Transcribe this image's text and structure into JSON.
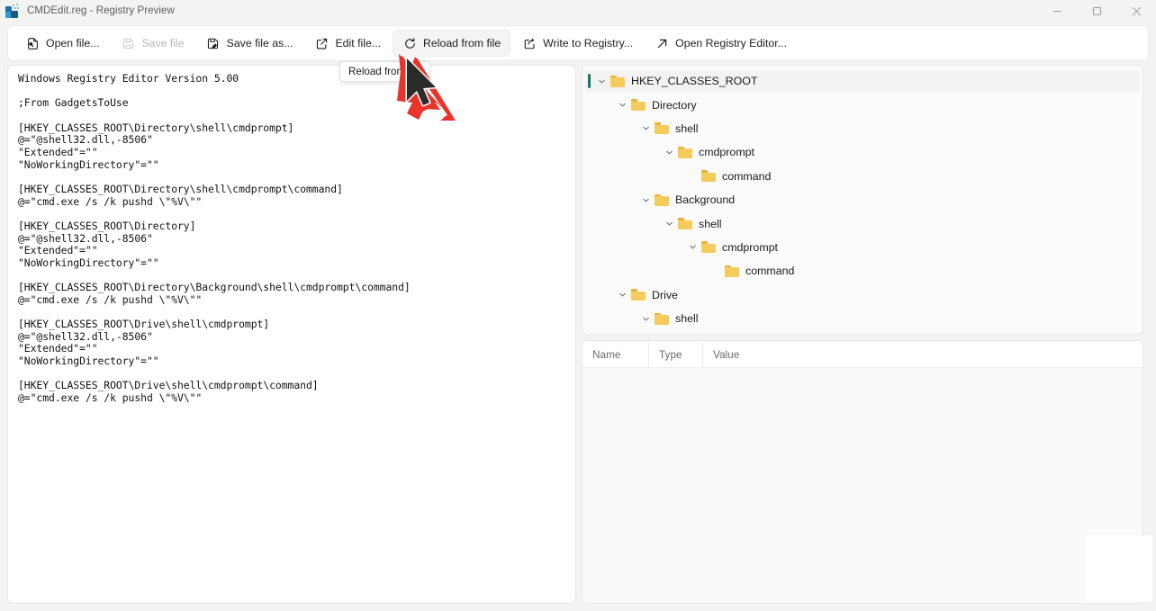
{
  "window": {
    "title": "CMDEdit.reg - Registry Preview",
    "app_icon": "registry-preview-icon",
    "controls": {
      "minimize": "minimize-icon",
      "maximize": "maximize-restore-icon",
      "close": "close-icon"
    }
  },
  "toolbar": {
    "buttons": [
      {
        "label": "Open file...",
        "icon": "open-file-icon",
        "disabled": false,
        "hovered": false
      },
      {
        "label": "Save file",
        "icon": "save-file-icon",
        "disabled": true,
        "hovered": false
      },
      {
        "label": "Save file as...",
        "icon": "save-file-as-icon",
        "disabled": false,
        "hovered": false
      },
      {
        "label": "Edit file...",
        "icon": "edit-file-icon",
        "disabled": false,
        "hovered": false
      },
      {
        "label": "Reload from file",
        "icon": "reload-icon",
        "disabled": false,
        "hovered": true
      },
      {
        "label": "Write to Registry...",
        "icon": "write-to-registry-icon",
        "disabled": false,
        "hovered": false
      },
      {
        "label": "Open Registry Editor...",
        "icon": "open-registry-editor-icon",
        "disabled": false,
        "hovered": false
      }
    ]
  },
  "tooltip": {
    "visible": true,
    "text": "Reload from file"
  },
  "editor": {
    "content": "Windows Registry Editor Version 5.00\n\n;From GadgetsToUse\n\n[HKEY_CLASSES_ROOT\\Directory\\shell\\cmdprompt]\n@=\"@shell32.dll,-8506\"\n\"Extended\"=\"\"\n\"NoWorkingDirectory\"=\"\"\n\n[HKEY_CLASSES_ROOT\\Directory\\shell\\cmdprompt\\command]\n@=\"cmd.exe /s /k pushd \\\"%V\\\"\"\n\n[HKEY_CLASSES_ROOT\\Directory]\n@=\"@shell32.dll,-8506\"\n\"Extended\"=\"\"\n\"NoWorkingDirectory\"=\"\"\n\n[HKEY_CLASSES_ROOT\\Directory\\Background\\shell\\cmdprompt\\command]\n@=\"cmd.exe /s /k pushd \\\"%V\\\"\"\n\n[HKEY_CLASSES_ROOT\\Drive\\shell\\cmdprompt]\n@=\"@shell32.dll,-8506\"\n\"Extended\"=\"\"\n\"NoWorkingDirectory\"=\"\"\n\n[HKEY_CLASSES_ROOT\\Drive\\shell\\cmdprompt\\command]\n@=\"cmd.exe /s /k pushd \\\"%V\\\"\""
  },
  "tree": {
    "selection_accent": "#0f7b6c",
    "nodes": [
      {
        "label": "HKEY_CLASSES_ROOT",
        "depth": 0,
        "expanded": true,
        "selected": true
      },
      {
        "label": "Directory",
        "depth": 1,
        "expanded": true,
        "selected": false
      },
      {
        "label": "shell",
        "depth": 2,
        "expanded": true,
        "selected": false
      },
      {
        "label": "cmdprompt",
        "depth": 3,
        "expanded": true,
        "selected": false
      },
      {
        "label": "command",
        "depth": 4,
        "expanded": null,
        "selected": false
      },
      {
        "label": "Background",
        "depth": 2,
        "expanded": true,
        "selected": false
      },
      {
        "label": "shell",
        "depth": 3,
        "expanded": true,
        "selected": false
      },
      {
        "label": "cmdprompt",
        "depth": 4,
        "expanded": true,
        "selected": false
      },
      {
        "label": "command",
        "depth": 5,
        "expanded": null,
        "selected": false
      },
      {
        "label": "Drive",
        "depth": 1,
        "expanded": true,
        "selected": false
      },
      {
        "label": "shell",
        "depth": 2,
        "expanded": true,
        "selected": false
      }
    ]
  },
  "values_table": {
    "columns": [
      "Name",
      "Type",
      "Value"
    ],
    "rows": []
  },
  "annotation": {
    "arrow_color": "#e8342a",
    "cursor": "mouse-pointer"
  }
}
